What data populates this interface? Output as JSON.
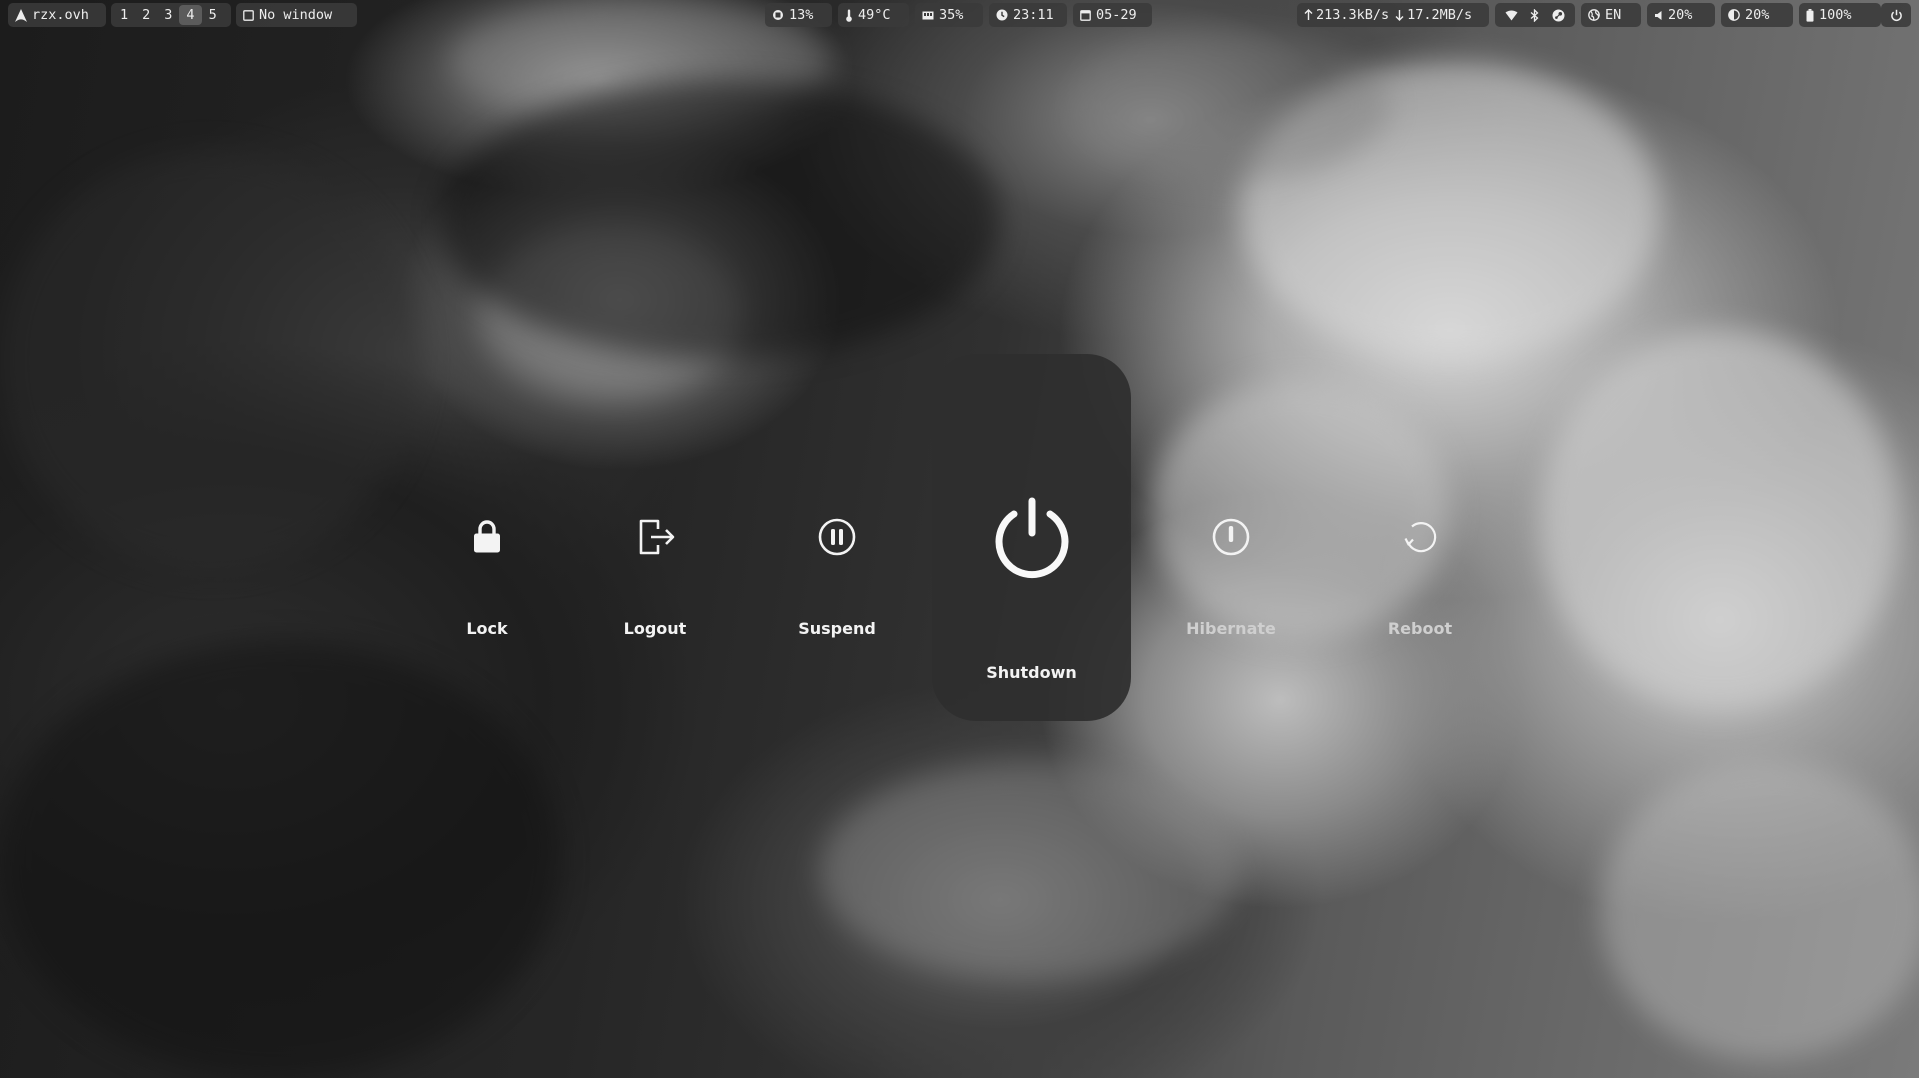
{
  "topbar": {
    "host": "rzx.ovh",
    "workspaces": [
      "1",
      "2",
      "3",
      "4",
      "5"
    ],
    "active_workspace": "4",
    "window_title": "No window",
    "cpu": "13%",
    "temperature": "49°C",
    "memory": "35%",
    "time": "23:11",
    "date": "05-29",
    "net_up": "213.3kB/s",
    "net_down": "17.2MB/s",
    "language": "EN",
    "volume": "20%",
    "brightness": "20%",
    "battery": "100%"
  },
  "power_menu": {
    "lock": "Lock",
    "logout": "Logout",
    "suspend": "Suspend",
    "shutdown": "Shutdown",
    "hibernate": "Hibernate",
    "reboot": "Reboot"
  },
  "colors": {
    "bar_pill": "#3a3a3a",
    "active_workspace": "#5b5b5b",
    "card": "#2e2e2e",
    "text": "#f3f3f3"
  }
}
